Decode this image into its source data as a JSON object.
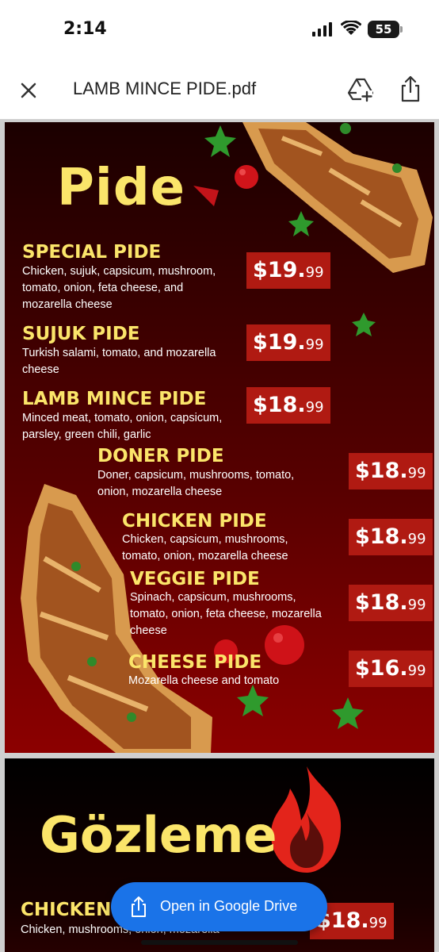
{
  "status": {
    "time": "2:14",
    "battery": "55"
  },
  "appbar": {
    "title": "LAMB MINCE PIDE.pdf"
  },
  "page1": {
    "title": "Pide",
    "items": [
      {
        "name": "SPECIAL PIDE",
        "desc_lines": [
          "Chicken, sujuk, capsicum, mushroom,",
          "tomato, onion, feta cheese, and",
          "mozarella cheese"
        ],
        "price_main": "$19.",
        "price_cents": "99"
      },
      {
        "name": "SUJUK PIDE",
        "desc_lines": [
          "Turkish salami, tomato, and mozarella",
          "cheese"
        ],
        "price_main": "$19.",
        "price_cents": "99"
      },
      {
        "name": "LAMB MINCE PIDE",
        "desc_lines": [
          "Minced meat, tomato, onion, capsicum,",
          "parsley, green chili, garlic"
        ],
        "price_main": "$18.",
        "price_cents": "99"
      },
      {
        "name": "DONER PIDE",
        "desc_lines": [
          "Doner, capsicum, mushrooms, tomato,",
          "onion, mozarella cheese"
        ],
        "price_main": "$18.",
        "price_cents": "99"
      },
      {
        "name": "CHICKEN PIDE",
        "desc_lines": [
          "Chicken, capsicum, mushrooms,",
          "tomato, onion, mozarella cheese"
        ],
        "price_main": "$18.",
        "price_cents": "99"
      },
      {
        "name": "VEGGIE PIDE",
        "desc_lines": [
          "Spinach, capsicum, mushrooms,",
          "tomato, onion, feta cheese, mozarella",
          "cheese"
        ],
        "price_main": "$18.",
        "price_cents": "99"
      },
      {
        "name": "CHEESE PIDE",
        "desc_lines": [
          "Mozarella cheese and tomato"
        ],
        "price_main": "$16.",
        "price_cents": "99"
      }
    ]
  },
  "page2": {
    "title": "Gözleme",
    "item": {
      "name": "CHICKEN",
      "desc": "Chicken, mushrooms, onion, mozarella",
      "price_main": "$18.",
      "price_cents": "99"
    }
  },
  "drive_button": {
    "label": "Open in Google Drive"
  },
  "colors": {
    "accent_yellow": "#fbe56a",
    "price_red": "#b01a12",
    "drive_blue": "#1a73e8"
  }
}
